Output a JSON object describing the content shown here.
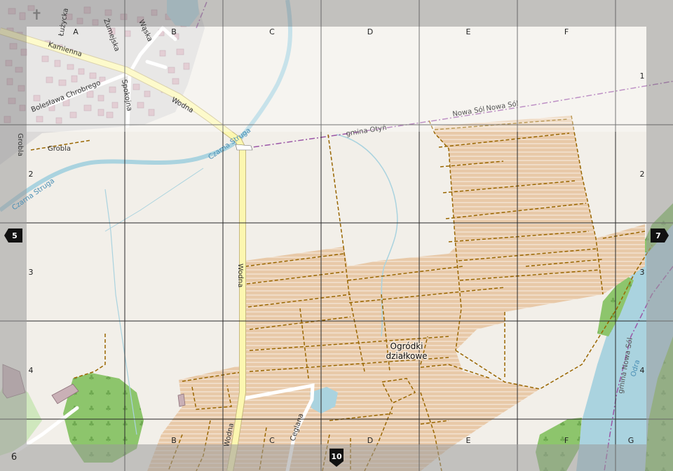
{
  "map": {
    "grid": {
      "columns_top": [
        "A",
        "B",
        "C",
        "D",
        "E",
        "F"
      ],
      "columns_bottom": [
        "B",
        "C",
        "D",
        "E",
        "F",
        "G"
      ],
      "rows_right": [
        "1",
        "2",
        "3",
        "4"
      ],
      "rows_left": [
        "2",
        "3",
        "4"
      ],
      "corner_row": "6"
    },
    "page_refs": {
      "left": "5",
      "right": "7",
      "bottom": "10"
    },
    "streets": {
      "luzycka": "Łużycka",
      "zumejska": "Żumejska",
      "waska": "Wąska",
      "kamienna": "Kamienna",
      "chrobrego": "Bolesława Chrobrego",
      "spokojna": "Spokojna",
      "wodna_top": "Wodna",
      "wodna_mid": "Wodna",
      "wodna_bottom": "Wodna",
      "grobla": "Grobla",
      "grobla_vertical": "Grobla",
      "ceglana": "Ceglana"
    },
    "water": {
      "czarna_struga_1": "Czarna Struga",
      "czarna_struga_2": "Czarna Struga",
      "odra": "Odra"
    },
    "boundaries": {
      "gmina_otyn": "gmina Otyń",
      "nowa_sol_1": "Nowa Sól",
      "nowa_sol_2": "Nowa Sól",
      "gmina_nowa_sol": "gmina Nowa Sól"
    },
    "areas": {
      "allotments_line1": "Ogródki",
      "allotments_line2": "działkowe"
    },
    "colors": {
      "background": "#f2efe9",
      "residential": "#e0dfdf",
      "allotments": "#eecfb3",
      "forest": "#8dc56c",
      "water": "#aad3df",
      "main_road": "#fcf7b0",
      "track": "#996600",
      "boundary": "#9b56a7",
      "grid": "#333333",
      "frame": "#b8b8b8"
    }
  }
}
